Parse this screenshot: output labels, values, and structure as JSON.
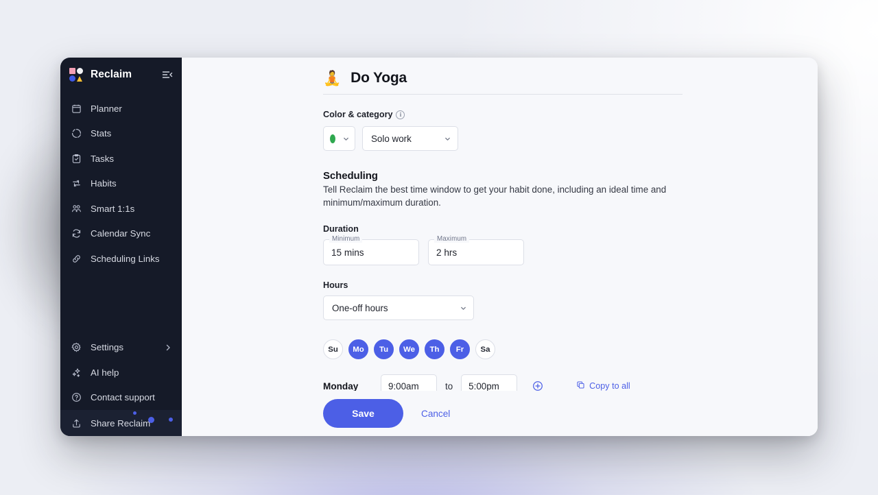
{
  "sidebar": {
    "brand": "Reclaim",
    "logo_colors": {
      "square": "#f4a0b5",
      "circle_white": "#f2f3f6",
      "circle_blue": "#3f59e4",
      "triangle": "#fbc034"
    },
    "items": [
      {
        "label": "Planner",
        "icon": "calendar-icon"
      },
      {
        "label": "Stats",
        "icon": "stats-circle-icon"
      },
      {
        "label": "Tasks",
        "icon": "clipboard-check-icon"
      },
      {
        "label": "Habits",
        "icon": "repeat-icon"
      },
      {
        "label": "Smart 1:1s",
        "icon": "people-icon"
      },
      {
        "label": "Calendar Sync",
        "icon": "sync-icon"
      },
      {
        "label": "Scheduling Links",
        "icon": "link-icon"
      }
    ],
    "bottom_items": [
      {
        "label": "Settings",
        "icon": "gear-icon",
        "chevron": true
      },
      {
        "label": "AI help",
        "icon": "sparkles-icon",
        "chevron": false
      },
      {
        "label": "Contact support",
        "icon": "question-circle-icon",
        "chevron": false
      },
      {
        "label": "Share Reclaim",
        "icon": "share-upload-icon",
        "chevron": false
      }
    ]
  },
  "header": {
    "emoji": "🧘",
    "title": "Do Yoga"
  },
  "color_category": {
    "label": "Color & category",
    "swatch_color": "#2fa84f",
    "category_value": "Solo work"
  },
  "scheduling": {
    "heading": "Scheduling",
    "description": "Tell Reclaim the best time window to get your habit done, including an ideal time and minimum/maximum duration.",
    "duration_label": "Duration",
    "minimum_legend": "Minimum",
    "minimum_value": "15 mins",
    "maximum_legend": "Maximum",
    "maximum_value": "2 hrs",
    "hours_label": "Hours",
    "hours_value": "One-off hours",
    "days": [
      {
        "label": "Su",
        "selected": false
      },
      {
        "label": "Mo",
        "selected": true
      },
      {
        "label": "Tu",
        "selected": true
      },
      {
        "label": "We",
        "selected": true
      },
      {
        "label": "Th",
        "selected": true
      },
      {
        "label": "Fr",
        "selected": true
      },
      {
        "label": "Sa",
        "selected": false
      }
    ],
    "time_row": {
      "day_name": "Monday",
      "start": "9:00am",
      "to": "to",
      "end": "5:00pm",
      "copy_all": "Copy to all"
    }
  },
  "footer": {
    "save_label": "Save",
    "cancel_label": "Cancel",
    "accent_color": "#4c5fe6"
  }
}
